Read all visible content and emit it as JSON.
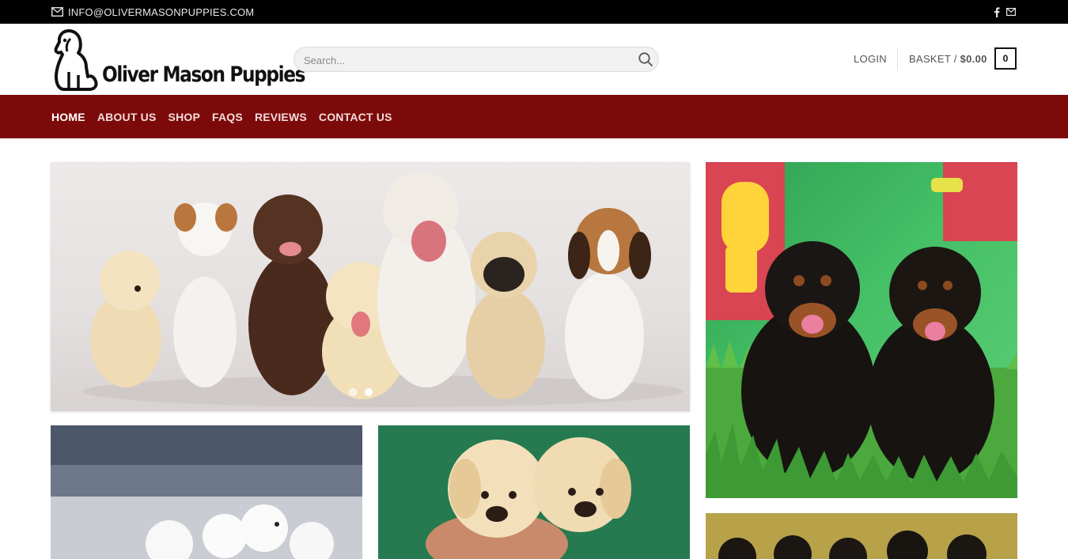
{
  "topbar": {
    "email": "INFO@OLIVERMASONPUPPIES.COM",
    "social_icons": [
      "facebook-icon",
      "email-icon"
    ]
  },
  "header": {
    "logo_text": "Oliver Mason Puppies",
    "search_placeholder": "Search...",
    "login_label": "LOGIN",
    "basket_label": "BASKET / ",
    "basket_amount": "$0.00",
    "basket_count": "0"
  },
  "nav": {
    "items": [
      {
        "label": "HOME",
        "active": true
      },
      {
        "label": "ABOUT US"
      },
      {
        "label": "SHOP"
      },
      {
        "label": "FAQS"
      },
      {
        "label": "REVIEWS"
      },
      {
        "label": "CONTACT US"
      }
    ]
  },
  "hero": {
    "slides": 2,
    "active_slide": 2
  },
  "colors": {
    "topbar_bg": "#000000",
    "nav_bg": "#7d0a0a",
    "page_bg": "#ffffff"
  }
}
